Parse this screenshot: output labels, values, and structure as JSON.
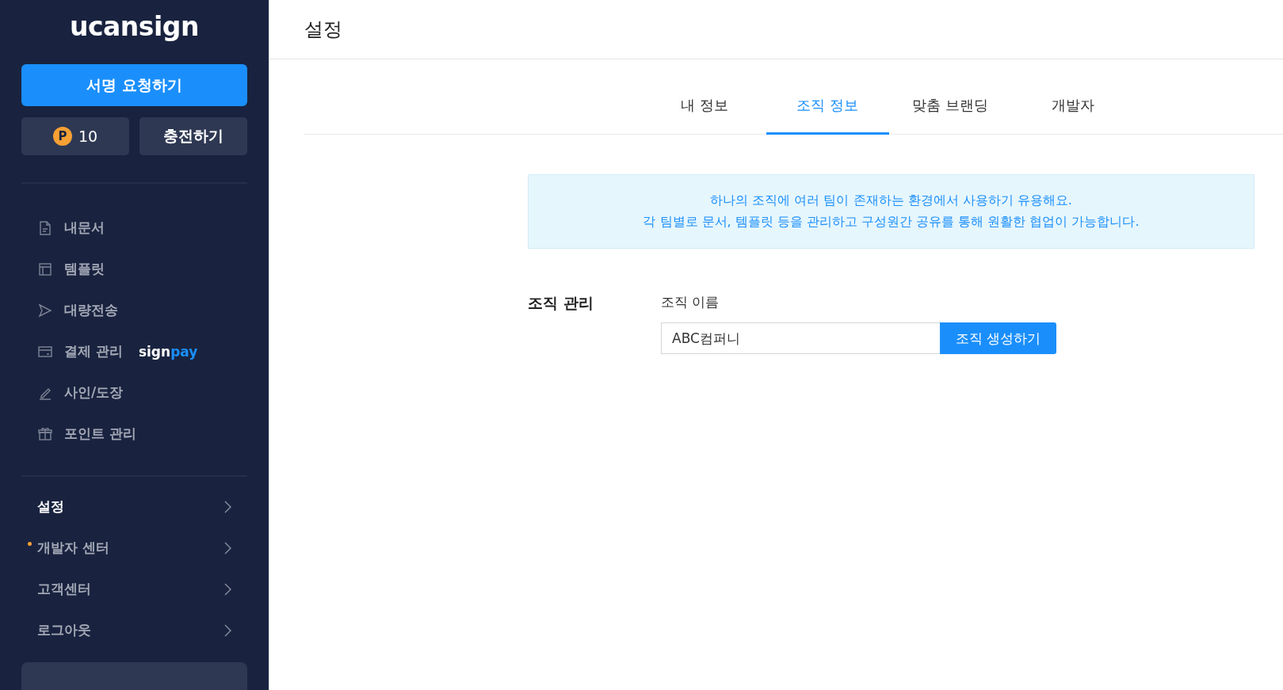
{
  "sidebar": {
    "logo": "ucansign",
    "primary_button": "서명 요청하기",
    "points": {
      "badge": "P",
      "value": "10"
    },
    "charge_button": "충전하기",
    "menu": [
      {
        "label": "내문서"
      },
      {
        "label": "템플릿"
      },
      {
        "label": "대량전송"
      },
      {
        "label": "결제 관리",
        "tag": [
          "sign",
          "pay"
        ]
      },
      {
        "label": "사인/도장"
      },
      {
        "label": "포인트 관리"
      }
    ],
    "links": [
      {
        "label": "설정",
        "selected": true,
        "dot": false
      },
      {
        "label": "개발자 센터",
        "selected": false,
        "dot": true
      },
      {
        "label": "고객센터",
        "selected": false,
        "dot": false
      },
      {
        "label": "로그아웃",
        "selected": false,
        "dot": false
      }
    ]
  },
  "header": {
    "title": "설정"
  },
  "tabs": [
    {
      "label": "내 정보",
      "selected": false
    },
    {
      "label": "조직 정보",
      "selected": true
    },
    {
      "label": "맞춤 브랜딩",
      "selected": false
    },
    {
      "label": "개발자",
      "selected": false
    }
  ],
  "notice": [
    "하나의 조직에 여러 팀이 존재하는 환경에서 사용하기 유용해요.",
    "각 팀별로 문서, 템플릿 등을 관리하고 구성원간 공유를 통해 원활한 협업이 가능합니다."
  ],
  "section": {
    "title": "조직 관리",
    "field_label": "조직 이름",
    "value": "ABC컴퍼니",
    "button": "조직 생성하기"
  }
}
